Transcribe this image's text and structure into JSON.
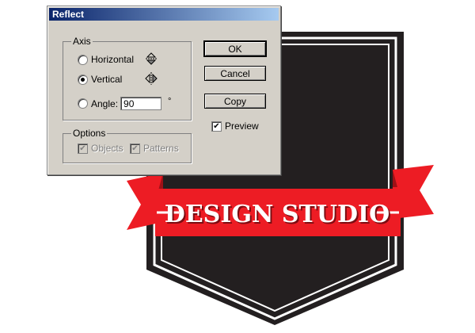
{
  "dialog": {
    "title": "Reflect",
    "axis_group": {
      "label": "Axis",
      "options": [
        {
          "label": "Horizontal",
          "checked": false,
          "icon": "reflect-horizontal-icon"
        },
        {
          "label": "Vertical",
          "checked": true,
          "icon": "reflect-vertical-icon"
        },
        {
          "label": "Angle:",
          "checked": false
        }
      ],
      "angle_value": "90",
      "angle_unit": "°"
    },
    "options_group": {
      "label": "Options",
      "objects_label": "Objects",
      "patterns_label": "Patterns",
      "objects_checked": true,
      "patterns_checked": true
    },
    "buttons": {
      "ok": "OK",
      "cancel": "Cancel",
      "copy": "Copy"
    },
    "preview_label": "Preview",
    "preview_checked": true
  },
  "artwork": {
    "banner_text": "DESIGN STUDIO",
    "colors": {
      "badge": "#231f20",
      "ribbon": "#ed1c24",
      "ribbon_dark": "#9e1016",
      "outline": "#ffffff"
    }
  }
}
